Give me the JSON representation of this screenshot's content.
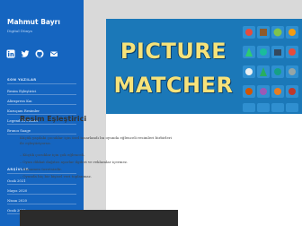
{
  "site": {
    "title": "Mahmut Bayrı",
    "tagline": "Digital Dünya"
  },
  "social": [
    {
      "icon": "linkedin-icon"
    },
    {
      "icon": "twitter-icon"
    },
    {
      "icon": "github-icon"
    },
    {
      "icon": "email-icon"
    }
  ],
  "recent": {
    "title": "SON YAZILAR",
    "items": [
      "Resim Eşleştirici",
      "Aliexpress Kaı",
      "Kuzuçam Resimler",
      "Legend Of Fosses",
      "Brunoı Saage"
    ]
  },
  "archives": {
    "title": "ARŞİVLER",
    "items": [
      "Ocak 2021",
      "Mayıs 2020",
      "Nisan 2020",
      "Ocak 2019"
    ]
  },
  "post": {
    "hero_line1": "PICTURE",
    "hero_line2": "MATCHER",
    "title": "Resim Eşleştirici",
    "intro1": "Küçük yaşdaki çocuklar için özel tasarlandı bu oyunda eğlenceli resimleri birbirleri",
    "intro2": "ile eşleştiriyoruz.",
    "features": [
      "– Küçük çocuklar için çok eğlenceli.",
      "– Oyun dikkat dağıtıcı ayarlar ilgileri ve reklamlar içermez.",
      "– Tamamen ücretsizdir.",
      "– Oyunda hiç bir kişisel veri toplanmaz."
    ]
  },
  "colors": {
    "sidebar": "#1565c0",
    "hero": "#1b78b8",
    "hero_text": "#f6e27a"
  }
}
